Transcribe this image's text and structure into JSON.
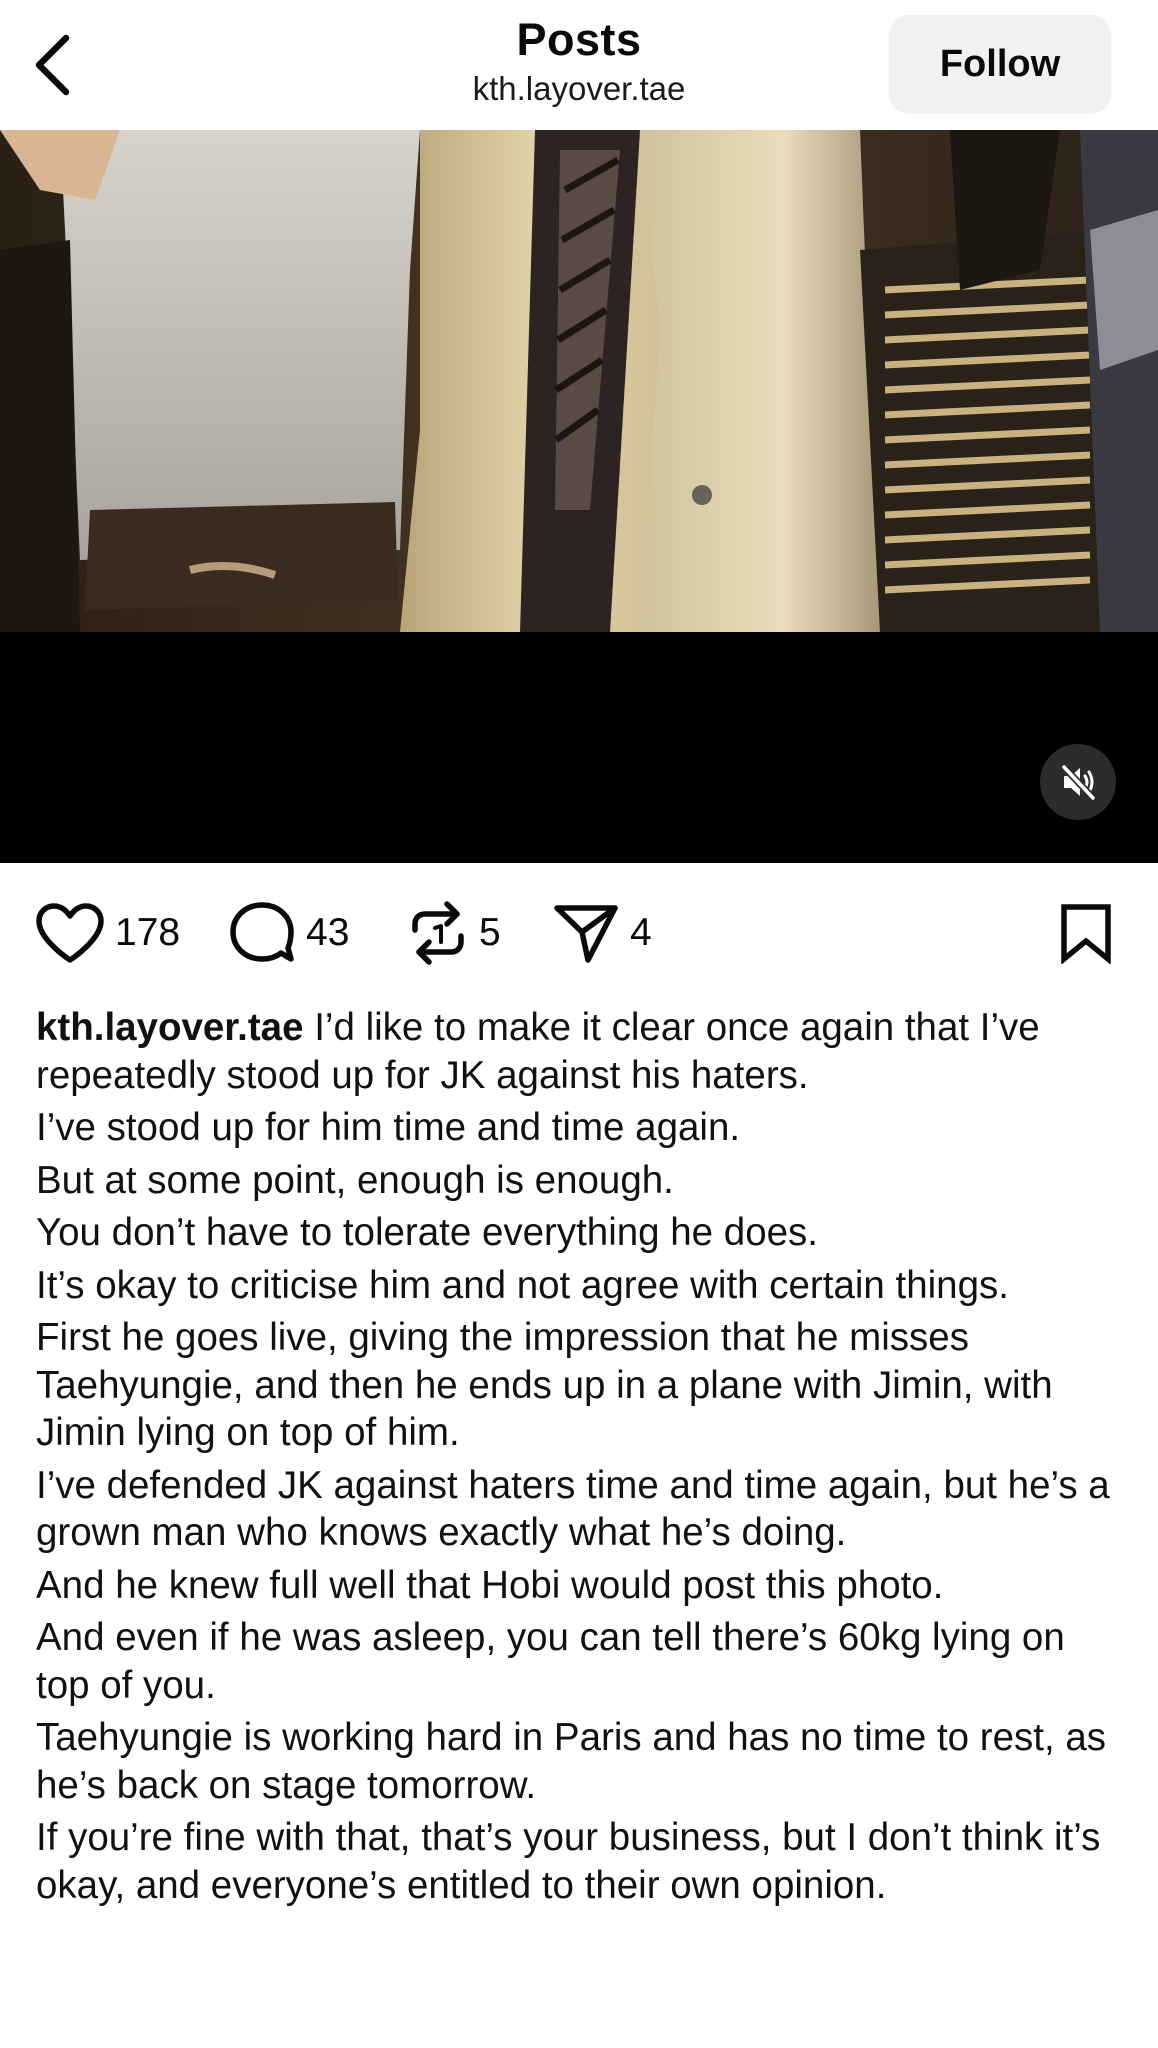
{
  "header": {
    "title": "Posts",
    "subtitle": "kth.layover.tae",
    "follow_label": "Follow"
  },
  "media": {
    "muted": true
  },
  "actions": {
    "likes": "178",
    "comments": "43",
    "reposts": "5",
    "shares": "4"
  },
  "caption": {
    "username": "kth.layover.tae",
    "first_line": " I’d like to make it clear once again that I’ve repeatedly stood up for JK against his haters.",
    "paragraphs": [
      "I’ve stood up for him time and time again.",
      "But at some point, enough is enough.",
      "You don’t have to tolerate everything he does.",
      "It’s okay to criticise him and not agree with certain things.",
      "First he goes live, giving the impression that he misses Taehyungie, and then he ends up in a plane with Jimin, with Jimin lying on top of him.",
      "I’ve defended JK against haters time and time again, but he’s a grown man who knows exactly what he’s doing.",
      "And he knew full well that Hobi would post this photo.",
      "And even if he was asleep, you can tell there’s 60kg lying on top of you.",
      "Taehyungie is working hard in Paris and has no time to rest, as he’s back on stage tomorrow.",
      "If you’re fine with that, that’s your business, but I don’t think it’s okay, and everyone’s entitled to their own opinion."
    ]
  },
  "colors": {
    "follow_bg": "#eff1f3",
    "media_bg": "#000000",
    "text": "#0a0a0a"
  }
}
